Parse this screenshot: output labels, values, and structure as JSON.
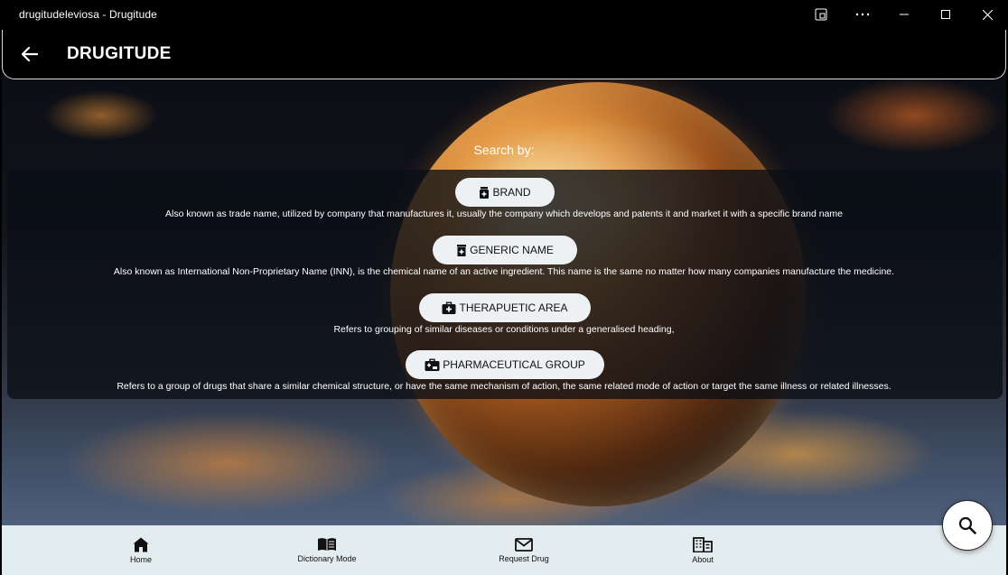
{
  "window": {
    "title": "drugitudeleviosa - Drugitude"
  },
  "header": {
    "title": "DRUGITUDE"
  },
  "search": {
    "heading": "Search by:",
    "options": [
      {
        "label": "BRAND",
        "icon": "medicine-bottle-icon",
        "description": "Also known as trade name, utilized by company that manufactures it, usually the company which develops and patents it and market it with a specific brand name"
      },
      {
        "label": "GENERIC NAME",
        "icon": "medicine-box-icon",
        "description": "Also known as International Non-Proprietary Name (INN), is the chemical name of an active ingredient. This name is the same no matter how many companies manufacture the medicine."
      },
      {
        "label": "THERAPUETIC AREA",
        "icon": "medical-bag-icon",
        "description": "Refers to grouping of similar diseases or conditions under a generalised heading,"
      },
      {
        "label": "PHARMACEUTICAL GROUP",
        "icon": "medical-kit-icon",
        "description": "Refers to a group of drugs that share a similar chemical structure, or have the same mechanism of action, the same related mode of action or target the same illness or related illnesses."
      }
    ]
  },
  "nav": {
    "items": [
      {
        "label": "Home",
        "icon": "home-icon"
      },
      {
        "label": "Dictionary Mode",
        "icon": "book-icon"
      },
      {
        "label": "Request Drug",
        "icon": "mail-icon"
      },
      {
        "label": "About",
        "icon": "building-icon"
      }
    ]
  },
  "colors": {
    "header_bg": "#000000",
    "button_bg": "#eef1f3",
    "nav_bg": "#e3ecee"
  }
}
